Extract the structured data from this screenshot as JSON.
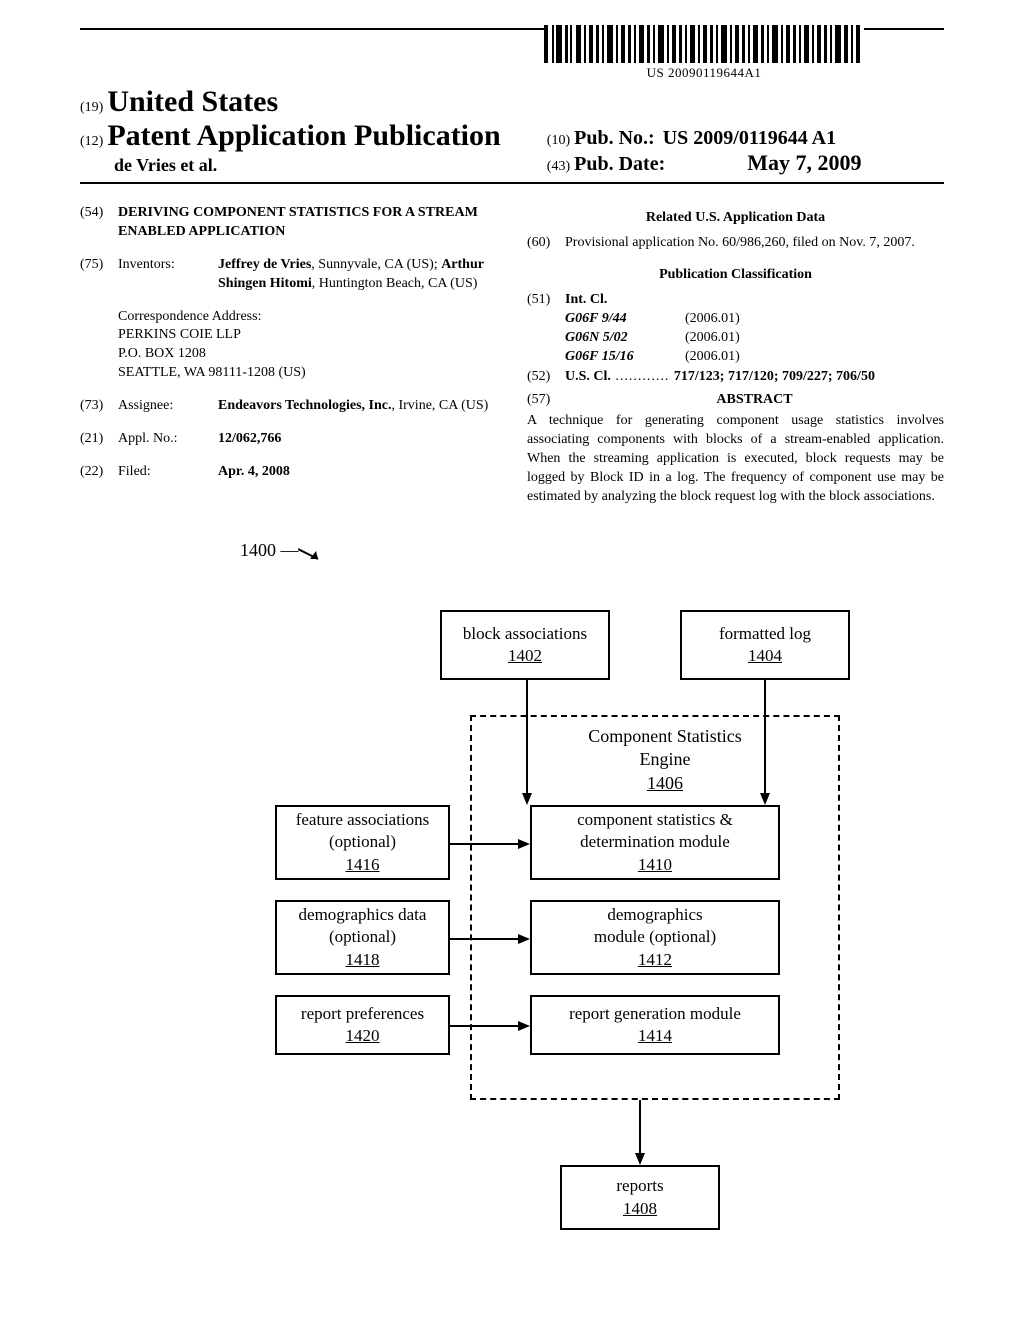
{
  "barcode_text": "US 20090119644A1",
  "header": {
    "code_19": "(19)",
    "country": "United States",
    "code_12": "(12)",
    "pub_type": "Patent Application Publication",
    "authors": "de Vries et al.",
    "code_10": "(10)",
    "pubno_label": "Pub. No.:",
    "pubno_value": "US 2009/0119644 A1",
    "code_43": "(43)",
    "pubdate_label": "Pub. Date:",
    "pubdate_value": "May 7, 2009"
  },
  "left_col": {
    "code_54": "(54)",
    "title": "DERIVING COMPONENT STATISTICS FOR A STREAM ENABLED APPLICATION",
    "code_75": "(75)",
    "inventors_label": "Inventors:",
    "inventors_html": "Jeffrey de Vries, Sunnyvale, CA (US); Arthur Shingen Hitomi, Huntington Beach, CA (US)",
    "corr_label": "Correspondence Address:",
    "corr_lines": [
      "PERKINS COIE LLP",
      "P.O. BOX 1208",
      "SEATTLE, WA 98111-1208 (US)"
    ],
    "code_73": "(73)",
    "assignee_label": "Assignee:",
    "assignee_value": "Endeavors Technologies, Inc., Irvine, CA (US)",
    "code_21": "(21)",
    "applno_label": "Appl. No.:",
    "applno_value": "12/062,766",
    "code_22": "(22)",
    "filed_label": "Filed:",
    "filed_value": "Apr. 4, 2008"
  },
  "right_col": {
    "related_heading": "Related U.S. Application Data",
    "code_60": "(60)",
    "provisional": "Provisional application No. 60/986,260, filed on Nov. 7, 2007.",
    "pubclass_heading": "Publication Classification",
    "code_51": "(51)",
    "intcl_label": "Int. Cl.",
    "intcl": [
      {
        "cls": "G06F 9/44",
        "yr": "(2006.01)"
      },
      {
        "cls": "G06N 5/02",
        "yr": "(2006.01)"
      },
      {
        "cls": "G06F 15/16",
        "yr": "(2006.01)"
      }
    ],
    "code_52": "(52)",
    "uscl_label": "U.S. Cl.",
    "uscl_dots": " ............ ",
    "uscl_value": "717/123; 717/120; 709/227; 706/50",
    "code_57": "(57)",
    "abstract_heading": "ABSTRACT",
    "abstract": "A technique for generating component usage statistics involves associating components with blocks of a stream-enabled application. When the streaming application is executed, block requests may be logged by Block ID in a log. The frequency of component use may be estimated by analyzing the block request log with the block associations."
  },
  "figure": {
    "ref": "1400",
    "boxes": {
      "b1402": {
        "lines": [
          "block associations"
        ],
        "ref": "1402"
      },
      "b1404": {
        "lines": [
          "formatted log"
        ],
        "ref": "1404"
      },
      "engine_title": {
        "lines": [
          "Component Statistics",
          "Engine"
        ],
        "ref": "1406"
      },
      "b1410": {
        "lines": [
          "component statistics &",
          "determination module"
        ],
        "ref": "1410"
      },
      "b1412": {
        "lines": [
          "demographics",
          "module (optional)"
        ],
        "ref": "1412"
      },
      "b1414": {
        "lines": [
          "report generation module"
        ],
        "ref": "1414"
      },
      "b1416": {
        "lines": [
          "feature associations",
          "(optional)"
        ],
        "ref": "1416"
      },
      "b1418": {
        "lines": [
          "demographics data",
          "(optional)"
        ],
        "ref": "1418"
      },
      "b1420": {
        "lines": [
          "report preferences"
        ],
        "ref": "1420"
      },
      "b1408": {
        "lines": [
          "reports"
        ],
        "ref": "1408"
      }
    }
  }
}
